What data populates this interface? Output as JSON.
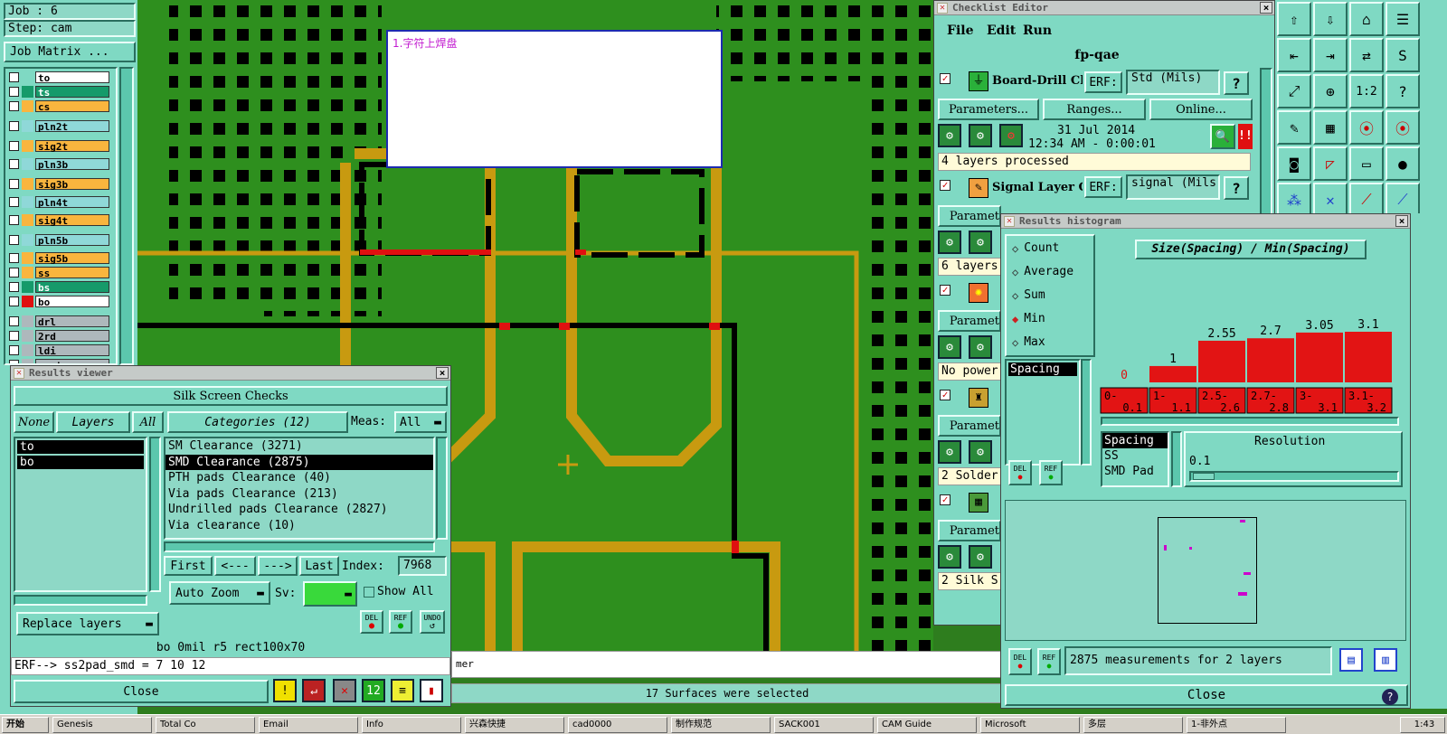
{
  "job_panel": {
    "job": "Job : 6",
    "step": "Step: cam",
    "job_matrix": "Job Matrix ..."
  },
  "layers": [
    {
      "name": "to",
      "color": "#ffffff"
    },
    {
      "name": "ts",
      "color": "#169a6a"
    },
    {
      "name": "cs",
      "color": "#f9b53e"
    },
    {
      "name": "pln2t",
      "color": "#8fd8d8"
    },
    {
      "name": "sig2t",
      "color": "#f9b53e"
    },
    {
      "name": "pln3b",
      "color": "#8fd8d8"
    },
    {
      "name": "sig3b",
      "color": "#f9b53e"
    },
    {
      "name": "pln4t",
      "color": "#8fd8d8"
    },
    {
      "name": "sig4t",
      "color": "#f9b53e"
    },
    {
      "name": "pln5b",
      "color": "#8fd8d8"
    },
    {
      "name": "sig5b",
      "color": "#f9b53e"
    },
    {
      "name": "ss",
      "color": "#f9b53e"
    },
    {
      "name": "bs",
      "color": "#169a6a"
    },
    {
      "name": "bo",
      "color": "#ffffff"
    },
    {
      "name": "drl",
      "color": "#aeb8bc"
    },
    {
      "name": "2rd",
      "color": "#aeb8bc"
    },
    {
      "name": "ldi",
      "color": "#aeb8bc"
    },
    {
      "name": "rout",
      "color": "#aeb8bc"
    }
  ],
  "note_popup": {
    "text": "1.字符上焊盘"
  },
  "results_viewer": {
    "title": "Results viewer",
    "header": "Silk Screen Checks",
    "none_btn": "None",
    "layers_btn": "Layers",
    "all_btn": "All",
    "categories_btn": "Categories (12)",
    "meas_label": "Meas:",
    "meas_value": "All",
    "layer_list": [
      "to",
      "bo"
    ],
    "categories": [
      "SM Clearance (3271)",
      "SMD Clearance (2875)",
      "PTH pads Clearance (40)",
      "Via pads Clearance (213)",
      "Undrilled pads Clearance (2827)",
      "Via clearance (10)"
    ],
    "first_btn": "First",
    "prev_btn": "<---",
    "next_btn": "--->",
    "last_btn": "Last",
    "index_label": "Index:",
    "index_value": "7968",
    "auto_zoom": "Auto Zoom",
    "sv_label": "Sv:",
    "show_all": "Show All",
    "replace_layers": "Replace layers",
    "del_label": "DEL",
    "ref_label": "REF",
    "undo_label": "UNDO",
    "info_line": "bo 0mil  r5  rect100x70",
    "erf_line": "ERF--> ss2pad_smd = 7 10 12",
    "close_btn": "Close"
  },
  "status": {
    "mer_text": "mer",
    "selected": "17 Surfaces were selected"
  },
  "checklist_editor": {
    "title": "Checklist Editor",
    "menu": [
      "File",
      "Edit",
      "Run"
    ],
    "checklist_name": "fp-qae",
    "check1": {
      "name": "Board-Drill Checks",
      "erf_label": "ERF:",
      "erf_value": "Std (Mils)",
      "help": "?"
    },
    "params_btn": "Parameters...",
    "ranges_btn": "Ranges...",
    "online_btn": "Online...",
    "date": "31 Jul 2014",
    "time": "12:34 AM - 0:00:01",
    "processed": "4 layers processed",
    "check2": {
      "name": "Signal Layer Checks",
      "erf_label": "ERF:",
      "erf_value": "signal (Mils)",
      "help": "?"
    },
    "params_short": "Paramet",
    "row_layers": "6 layers",
    "row_power": "No power",
    "row_solder": "2 Solder",
    "row_silk": "2 Silk S"
  },
  "histogram": {
    "title": "Results histogram",
    "options": [
      "Count",
      "Average",
      "Sum",
      "Min",
      "Max"
    ],
    "selected_option": "Min",
    "measure_list": [
      "Spacing"
    ],
    "chart_title": "Size(Spacing) / Min(Spacing)",
    "resolution_label": "Resolution",
    "resolution_value": "0.1",
    "type_list": [
      "Spacing",
      "SS",
      "SMD Pad"
    ],
    "measurements": "2875 measurements for 2 layers",
    "close_btn": "Close",
    "del_label": "DEL",
    "ref_label": "REF"
  },
  "chart_data": {
    "type": "bar",
    "title": "Size(Spacing) / Min(Spacing)",
    "categories": [
      "0-\n0.1",
      "1-\n1.1",
      "2.5-\n2.6",
      "2.7-\n2.8",
      "3-\n3.1",
      "3.1-\n3.2"
    ],
    "category_labels": [
      "0-",
      "1-",
      "2.5-",
      "2.7-",
      "3-",
      "3.1-"
    ],
    "category_labels2": [
      "0.1",
      "1.1",
      "2.6",
      "2.8",
      "3.1",
      "3.2"
    ],
    "values": [
      0,
      1,
      2.55,
      2.7,
      3.05,
      3.1
    ],
    "value_labels": [
      "0",
      "1",
      "2.55",
      "2.7",
      "3.05",
      "3.1"
    ],
    "ylim": [
      0,
      3.1
    ],
    "bar_color": "#e21414"
  },
  "taskbar": {
    "start": "开始",
    "items": [
      "Genesis",
      "Total Co",
      "Email",
      "Info",
      "兴森快捷",
      "cad0000",
      "制作规范",
      "SACK001",
      "CAM Guide",
      "Microsoft",
      "多层",
      "1-非外点"
    ],
    "clock": "1:43"
  }
}
